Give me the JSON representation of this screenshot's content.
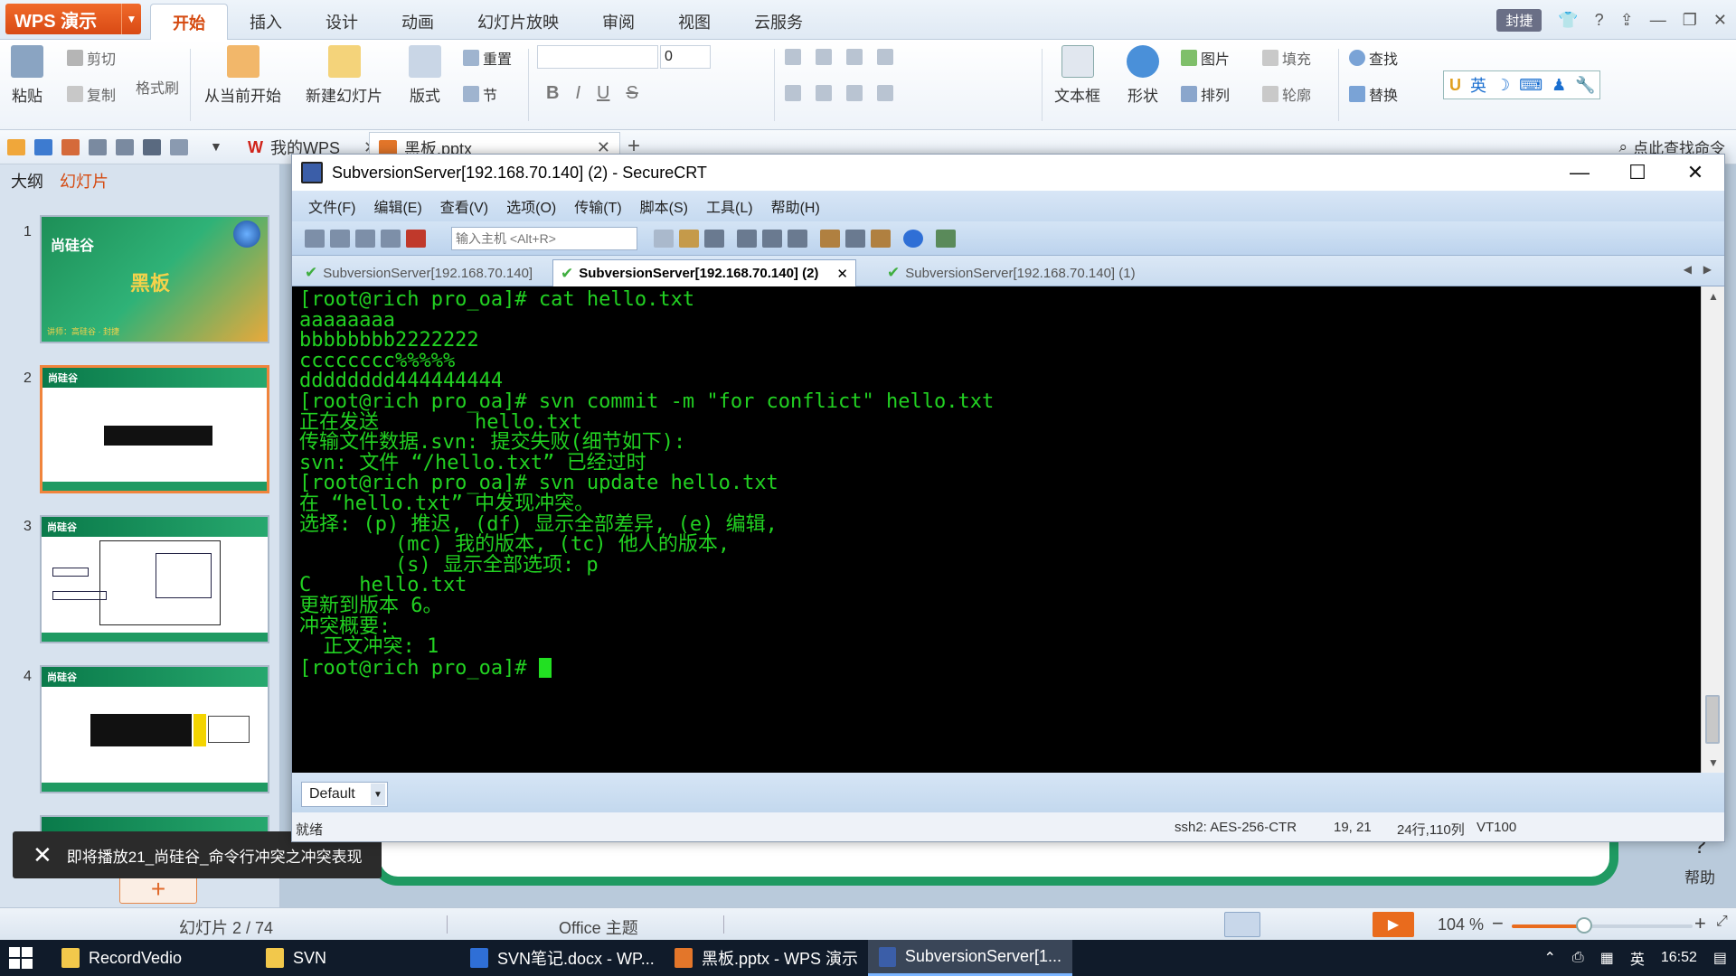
{
  "wps": {
    "app_name": "WPS 演示",
    "ribbon_tabs": [
      "开始",
      "插入",
      "设计",
      "动画",
      "幻灯片放映",
      "审阅",
      "视图",
      "云服务"
    ],
    "active_tab": "开始",
    "ribbon": {
      "paste": "粘贴",
      "cut": "剪切",
      "copy": "复制",
      "format_painter": "格式刷",
      "from_current": "从当前开始",
      "new_slide": "新建幻灯片",
      "layout": "版式",
      "reset": "重置",
      "section": "节",
      "font_size": "0",
      "textbox": "文本框",
      "shape": "形状",
      "picture": "图片",
      "fill": "填充",
      "arrange": "排列",
      "outline": "轮廓",
      "find": "查找",
      "replace": "替换",
      "ime_label": "英"
    },
    "top_right": {
      "user": "封捷",
      "help": "?"
    },
    "quick_tabs": [
      {
        "label": "我的WPS",
        "icon": "wps-logo-icon"
      },
      {
        "label": "黑板.pptx",
        "icon": "pptx-file-icon"
      }
    ],
    "find_command": "点此查找命令",
    "panel_tabs": {
      "outline": "大纲",
      "slides": "幻灯片"
    },
    "slides": [
      {
        "num": "1",
        "logo": "尚硅谷",
        "title": "黑板",
        "footer": "讲师：高硅谷 · 封捷"
      },
      {
        "num": "2",
        "logo": "尚硅谷"
      },
      {
        "num": "3",
        "logo": "尚硅谷"
      },
      {
        "num": "4",
        "logo": "尚硅谷"
      }
    ],
    "statusbar": {
      "slide": "幻灯片 2 / 74",
      "theme": "Office 主题",
      "zoom": "104 %"
    },
    "zoom_fraction": 0.4,
    "right_tools_help": "帮助",
    "notification": "即将播放21_尚硅谷_命令行冲突之冲突表现"
  },
  "crt": {
    "title": "SubversionServer[192.168.70.140] (2) - SecureCRT",
    "menu": [
      "文件(F)",
      "编辑(E)",
      "查看(V)",
      "选项(O)",
      "传输(T)",
      "脚本(S)",
      "工具(L)",
      "帮助(H)"
    ],
    "host_placeholder": "输入主机 <Alt+R>",
    "tabs": [
      {
        "label": "SubversionServer[192.168.70.140]",
        "active": false
      },
      {
        "label": "SubversionServer[192.168.70.140] (2)",
        "active": true
      },
      {
        "label": "SubversionServer[192.168.70.140] (1)",
        "active": false
      }
    ],
    "terminal_lines": [
      "[root@rich pro_oa]# cat hello.txt",
      "aaaaaaaa",
      "bbbbbbbb2222222",
      "cccccccc%%%%%",
      "dddddddd444444444",
      "[root@rich pro_oa]# svn commit -m \"for conflict\" hello.txt",
      "正在发送        hello.txt",
      "传输文件数据.svn: 提交失败(细节如下):",
      "svn: 文件 “/hello.txt” 已经过时",
      "[root@rich pro_oa]# svn update hello.txt",
      "在 “hello.txt” 中发现冲突。",
      "选择: (p) 推迟, (df) 显示全部差异, (e) 编辑,",
      "        (mc) 我的版本, (tc) 他人的版本,",
      "        (s) 显示全部选项: p",
      "C    hello.txt",
      "更新到版本 6。",
      "冲突概要:",
      "  正文冲突: 1"
    ],
    "prompt": "[root@rich pro_oa]# ",
    "session": "Default",
    "status": {
      "ready": "就绪",
      "cipher": "ssh2: AES-256-CTR",
      "cursor": "19, 21",
      "size": "24行,110列",
      "term": "VT100"
    }
  },
  "taskbar": {
    "items": [
      {
        "label": "RecordVedio",
        "active": false
      },
      {
        "label": "SVN",
        "active": false
      },
      {
        "label": "SVN笔记.docx - WP...",
        "active": false
      },
      {
        "label": "黑板.pptx - WPS 演示",
        "active": false
      },
      {
        "label": "SubversionServer[1...",
        "active": true
      }
    ],
    "ime": "英",
    "time": "16:52"
  },
  "colors": {
    "wps_orange": "#e96b1d",
    "terminal_bg": "#000000",
    "terminal_fg": "#22d122",
    "slide_green": "#1f9a62"
  }
}
